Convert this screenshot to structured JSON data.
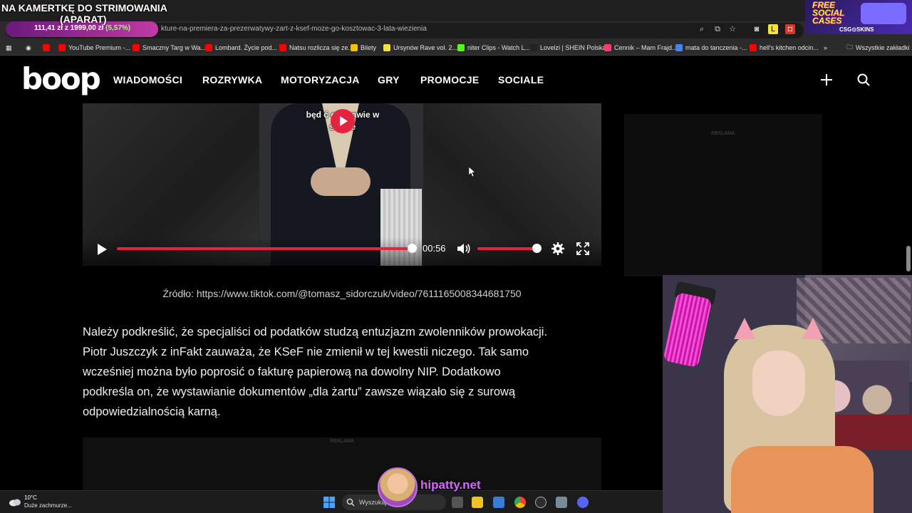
{
  "overlay": {
    "title": "NA KAMERTKĘ DO STRIMOWANIA",
    "subtitle": "(APARAT)",
    "price_current": "111,41 zł",
    "price_target": "1999,00 zł",
    "price_pct": "(5,57%)"
  },
  "promo": {
    "title": "FREE SOCIAL CASES",
    "brand": "CSG⊙SKINS"
  },
  "browser": {
    "url": "kture-na-premiera-za-prezerwatywy-zart-z-ksef-moze-go-kosztowac-3-lata-wiezienia",
    "bookmarks": [
      {
        "label": "YouTube Premium -...",
        "color": "#ff0000"
      },
      {
        "label": "Smaczny Targ w Wa...",
        "color": "#ff0000"
      },
      {
        "label": "Lombard. Życie pod...",
        "color": "#ff0000"
      },
      {
        "label": "Natsu rozlicza się ze...",
        "color": "#ff0000"
      },
      {
        "label": "Bilety",
        "color": "#f5c400"
      },
      {
        "label": "Ursynów Rave vol. 2...",
        "color": "#f5e23a"
      },
      {
        "label": "niter Clips - Watch L...",
        "color": "#53fc18"
      },
      {
        "label": "Lovelzi | SHEIN Polska",
        "color": "#222222"
      },
      {
        "label": "Cennik – Mam Frajd...",
        "color": "#ff3b6b"
      },
      {
        "label": "mata do tanczenia -...",
        "color": "#4285f4"
      },
      {
        "label": "hell's kitchen odcin...",
        "color": "#ff0000"
      }
    ],
    "all_bookmarks": "Wszystkie zakładki"
  },
  "site": {
    "logo": "boop",
    "nav": [
      "WIADOMOŚCI",
      "ROZRYWKA",
      "MOTORYZACJA",
      "GRY",
      "PROMOCJE",
      "SOCIALE"
    ]
  },
  "video": {
    "caption": "będ  ć o sprawie  w sądzie",
    "time": "00:56",
    "progress": 1.0,
    "volume": 1.0
  },
  "source_line": "Źródło: https://www.tiktok.com/@tomasz_sidorczuk/video/7611165008344681750",
  "article_lines": [
    "Należy podkreślić, że specjaliści od podatków studzą entuzjazm zwolenników prowokacji.",
    "Piotr Juszczyk z inFakt zauważa, że KSeF nie zmienił w tej kwestii niczego. Tak samo",
    "wcześniej można było poprosić o fakturę papierową na dowolny NIP. Dodatkowo",
    "podkreśla on, że wystawianie dokumentów „dla żartu” zawsze wiązało się z surową",
    "odpowiedzialnością karną."
  ],
  "ads": {
    "label": "REKLAMA"
  },
  "taskbar": {
    "weather_temp": "10°C",
    "weather_desc": "Duże zachmurze...",
    "search_label": "Wyszukaj"
  },
  "streamer": {
    "handle": "hipatty.net"
  },
  "colors": {
    "accent": "#e4233f",
    "brand_purple": "#d866ff"
  }
}
